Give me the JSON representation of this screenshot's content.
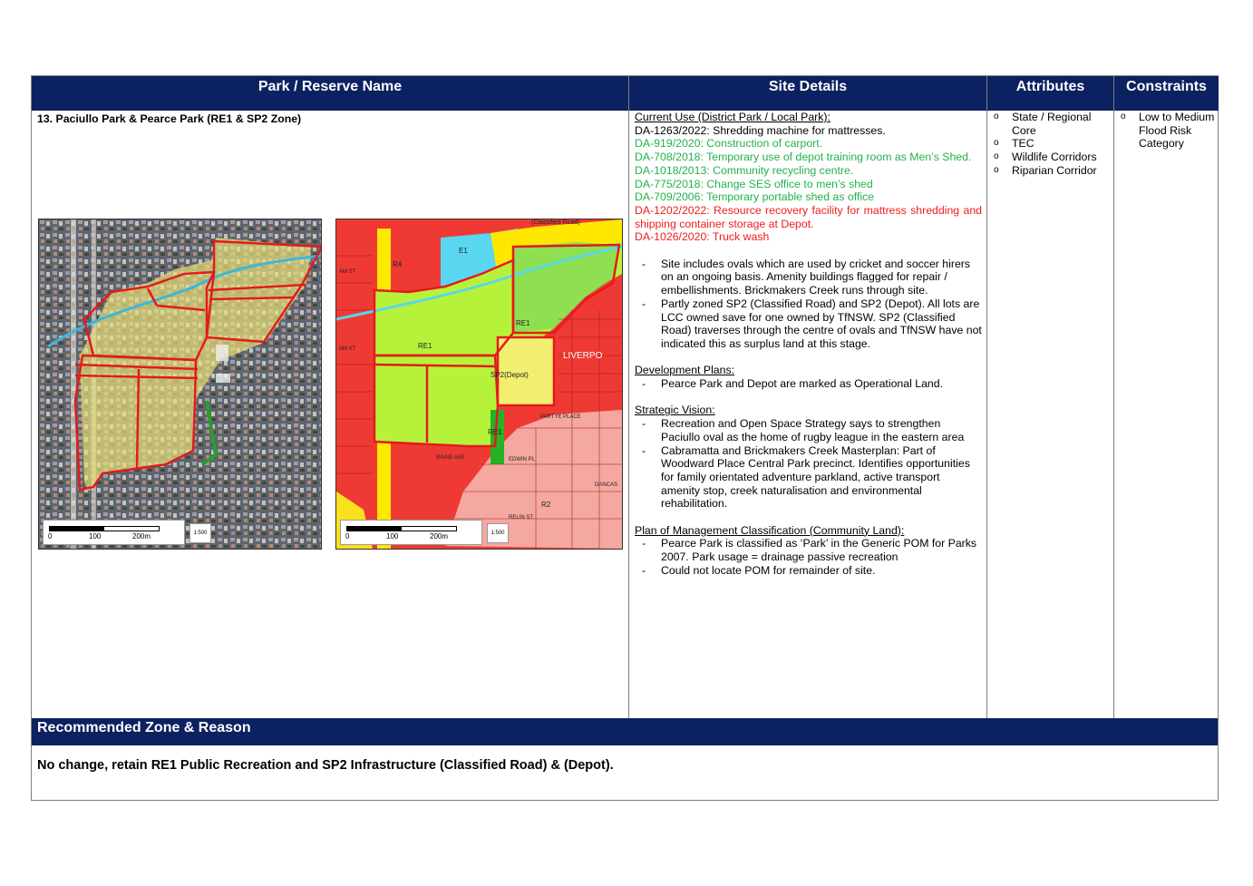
{
  "header": {
    "col1": "Park / Reserve Name",
    "col2": "Site Details",
    "col3": "Attributes",
    "col4": "Constraints"
  },
  "park": {
    "title": "13. Paciullo Park & Pearce Park (RE1 & SP2 Zone)"
  },
  "maps": {
    "aerial": {
      "scale_labels": [
        "0",
        "100",
        "200m"
      ],
      "north_label": "1:500"
    },
    "zoning": {
      "scale_labels": [
        "0",
        "100",
        "200m"
      ],
      "north_label": "1:500",
      "zone_labels": {
        "e1": "E1",
        "r4": "R4",
        "re1_a": "RE1",
        "re1_b": "RE1",
        "depot": "SP2(Depot)",
        "re1_small": "RE1",
        "r2": "R2",
        "liverpool": "LIVERPO",
        "classified": "(Classified Road)",
        "st1": "AM ST",
        "st2": "AM ST",
        "st3": "PARTYE PLACE",
        "st4": "RAINE AVE",
        "st5": "EDWIN PL",
        "st6": "DANCAS",
        "st7": "RELIN ST"
      }
    }
  },
  "site_details": {
    "current_use_heading": "Current Use (District Park / Local Park):",
    "da_black": "DA-1263/2022: Shredding machine for mattresses.",
    "da_green": [
      "DA-919/2020: Construction of carport.",
      "DA-708/2018: Temporary use of depot training room as Men’s Shed.",
      "DA-1018/2013: Community recycling centre.",
      "DA-775/2018: Change SES office to men’s shed",
      "DA-709/2006: Temporary portable shed as office"
    ],
    "da_red": [
      "DA-1202/2022: Resource recovery facility for mattress shredding and shipping container storage at Depot.",
      "DA-1026/2020: Truck wash"
    ],
    "bullets": [
      "Site includes ovals which are used by cricket and soccer hirers on an ongoing basis. Amenity buildings flagged for repair / embellishments. Brickmakers Creek runs through site.",
      "Partly zoned SP2 (Classified Road) and SP2 (Depot). All lots are LCC owned save for one owned by TfNSW. SP2 (Classified Road) traverses through the centre of ovals and TfNSW have not indicated this as surplus land at this stage."
    ],
    "dev_heading": "Development Plans:",
    "dev_bullets": [
      "Pearce Park and Depot are marked as Operational Land."
    ],
    "vision_heading": "Strategic Vision:",
    "vision_bullets": [
      "Recreation and Open Space Strategy says to strengthen Paciullo oval as the home of rugby league in the eastern area",
      "Cabramatta and Brickmakers Creek Masterplan: Part of Woodward Place Central Park precinct. Identifies opportunities for family orientated adventure parkland, active transport amenity stop, creek naturalisation and environmental rehabilitation."
    ],
    "pom_heading": "Plan of Management Classification (Community Land):",
    "pom_bullets": [
      "Pearce Park is classified as ‘Park’ in the Generic POM for Parks 2007. Park usage = drainage passive recreation",
      "Could not locate POM for remainder of site."
    ]
  },
  "attributes": [
    "State / Regional Core",
    "TEC",
    "Wildlife Corridors",
    "Riparian Corridor"
  ],
  "constraints": [
    "Low to Medium Flood Risk Category"
  ],
  "recommendation": {
    "heading": "Recommended Zone & Reason",
    "text": "No change, retain RE1 Public Recreation and SP2 Infrastructure (Classified Road) & (Depot)."
  }
}
